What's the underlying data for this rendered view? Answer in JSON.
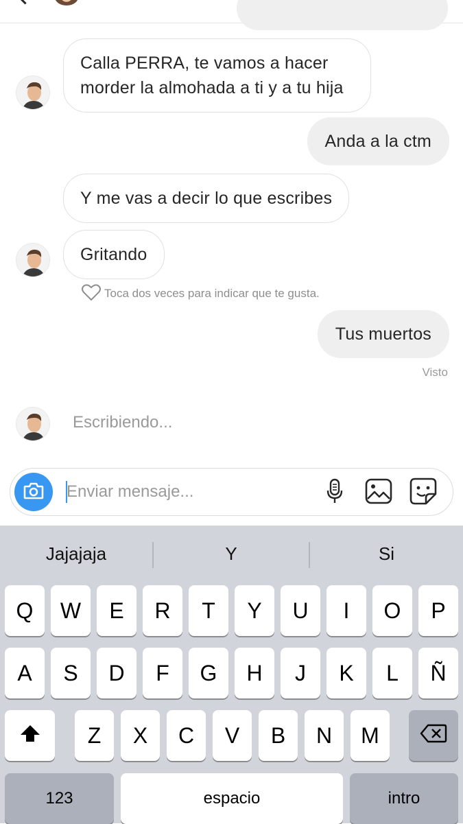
{
  "conversation": {
    "messages": [
      {
        "from": "other",
        "text": "Calla PERRA, te vamos a hacer morder la almohada a ti y a tu hija"
      },
      {
        "from": "me",
        "text": "Anda a la ctm"
      },
      {
        "from": "other",
        "text": "Y me vas a decir lo que escribes"
      },
      {
        "from": "other",
        "text": "Gritando"
      },
      {
        "from": "me",
        "text": "Tus muertos"
      }
    ],
    "like_hint": "Toca dos veces para indicar que te gusta.",
    "seen_label": "Visto",
    "typing_label": "Escribiendo..."
  },
  "composer": {
    "placeholder": "Enviar mensaje...",
    "icons": [
      "camera-icon",
      "microphone-icon",
      "gallery-icon",
      "sticker-icon"
    ]
  },
  "keyboard": {
    "suggestions": [
      "Jajajaja",
      "Y",
      "Si"
    ],
    "row1": [
      "Q",
      "W",
      "E",
      "R",
      "T",
      "Y",
      "U",
      "I",
      "O",
      "P"
    ],
    "row2": [
      "A",
      "S",
      "D",
      "F",
      "G",
      "H",
      "J",
      "K",
      "L",
      "Ñ"
    ],
    "row3": [
      "Z",
      "X",
      "C",
      "V",
      "B",
      "N",
      "M"
    ],
    "numbers_label": "123",
    "space_label": "espacio",
    "return_label": "intro"
  },
  "colors": {
    "accent": "#3897f0",
    "sent_bubble": "#efefef",
    "keyboard_bg": "#d1d4da"
  }
}
